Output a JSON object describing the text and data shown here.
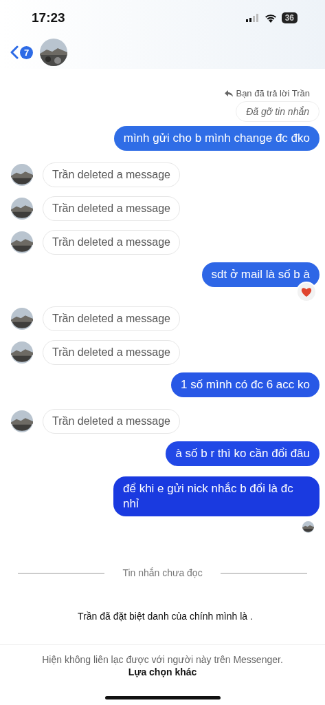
{
  "status_bar": {
    "time": "17:23",
    "battery": "36"
  },
  "header": {
    "back_count": "7"
  },
  "messages": [
    {
      "kind": "reply_note",
      "text": "Bạn đã trả lời Trần"
    },
    {
      "kind": "unsent",
      "text": "Đã gỡ tin nhắn"
    },
    {
      "kind": "outgoing",
      "text": "mình gửi cho b mình change đc đko",
      "color": "#2f6de6"
    },
    {
      "kind": "deleted",
      "text": "Trần deleted a message"
    },
    {
      "kind": "deleted",
      "text": "Trần deleted a message"
    },
    {
      "kind": "deleted",
      "text": "Trần deleted a message"
    },
    {
      "kind": "outgoing",
      "text": "sdt ở mail là số b à",
      "color": "#2e66e6",
      "reaction": true
    },
    {
      "kind": "deleted",
      "text": "Trần deleted a message"
    },
    {
      "kind": "deleted",
      "text": "Trần deleted a message"
    },
    {
      "kind": "outgoing",
      "text": "1 số mình có đc 6 acc ko",
      "color": "#2858e6"
    },
    {
      "kind": "deleted",
      "text": "Trần deleted a message"
    },
    {
      "kind": "outgoing",
      "text": "à số b r thì ko cần đổi đâu",
      "color": "#2148e6"
    },
    {
      "kind": "outgoing",
      "text": "để khi e gửi nick nhắc b đổi là đc nhỉ",
      "color": "#1a3ae0",
      "seen": true
    },
    {
      "kind": "divider",
      "text": "Tin nhắn chưa đọc"
    },
    {
      "kind": "event",
      "text": "Trần đã đặt biệt danh của chính mình là ."
    }
  ],
  "footer": {
    "text": "Hiện không liên lạc được với người này trên Messenger.",
    "link": "Lựa chọn khác"
  }
}
